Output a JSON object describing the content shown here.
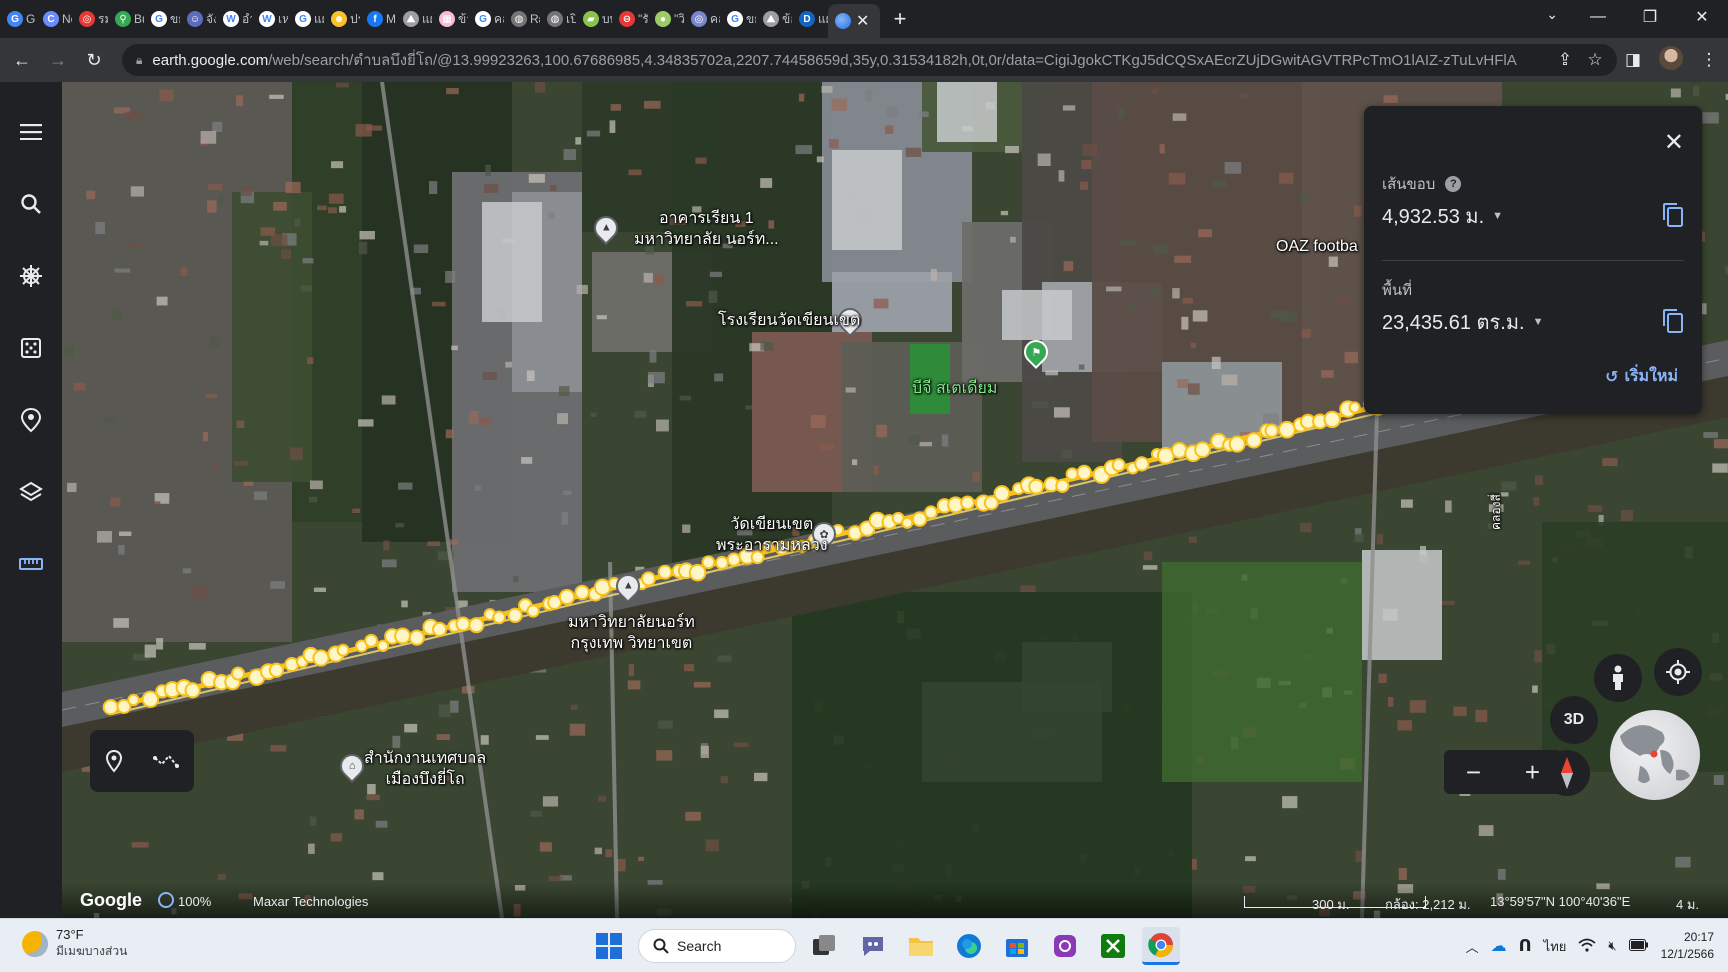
{
  "browser": {
    "tabs": [
      {
        "label": "Gc",
        "color": "#4285f4",
        "glyph": "G"
      },
      {
        "label": "Ne",
        "color": "#6b8cff",
        "glyph": "C"
      },
      {
        "label": "รม",
        "color": "#e53935",
        "glyph": "◎"
      },
      {
        "label": "Bu",
        "color": "#34a853",
        "glyph": "⚲"
      },
      {
        "label": "ขย",
        "color": "#ffffff",
        "glyph": "G"
      },
      {
        "label": "จัง",
        "color": "#5c6bc0",
        "glyph": "☺"
      },
      {
        "label": "อำ",
        "color": "#ffffff",
        "glyph": "W"
      },
      {
        "label": "เห",
        "color": "#ffffff",
        "glyph": "W"
      },
      {
        "label": "แผ",
        "color": "#ffffff",
        "glyph": "G"
      },
      {
        "label": "ปร",
        "color": "#fbc02d",
        "glyph": "☻"
      },
      {
        "label": "M",
        "color": "#1877f2",
        "glyph": "f"
      },
      {
        "label": "แผ",
        "color": "#9e9e9e",
        "glyph": "⛰"
      },
      {
        "label": "ข้า",
        "color": "#f8bbd0",
        "glyph": "▦"
      },
      {
        "label": "คล",
        "color": "#ffffff",
        "glyph": "G"
      },
      {
        "label": "Rε",
        "color": "#757575",
        "glyph": "◍"
      },
      {
        "label": "เปิ",
        "color": "#757575",
        "glyph": "◍"
      },
      {
        "label": "บท",
        "color": "#8bc34a",
        "glyph": "▰"
      },
      {
        "label": "\"รั",
        "color": "#e53935",
        "glyph": "⊖"
      },
      {
        "label": "\"วิ",
        "color": "#9ccc65",
        "glyph": "●"
      },
      {
        "label": "คล",
        "color": "#7986cb",
        "glyph": "◎"
      },
      {
        "label": "ขย",
        "color": "#ffffff",
        "glyph": "G"
      },
      {
        "label": "ข้อ",
        "color": "#9e9e9e",
        "glyph": "⛰"
      },
      {
        "label": "แผ",
        "color": "#1565c0",
        "glyph": "D"
      }
    ],
    "active_tab_glyph": "●",
    "url_host": "earth.google.com",
    "url_rest": "/web/search/ตำบลบึงยี่โถ/@13.99923263,100.67686985,4.34835702a,2207.74458659d,35y,0.31534182h,0t,0r/data=CigiJgokCTKgJ5dCQSxAEcrZUjDGwitAGVTRPcTmO1lAIZ-zTuLvHFlA"
  },
  "map": {
    "labels": {
      "building1": "อาคารเรียน 1",
      "building1_sub": "มหาวิทยาลัย นอร์ท...",
      "school": "โรงเรียนวัดเขียนเขต",
      "stadium": "บีจี สเตเดียม",
      "temple": "วัดเขียนเขต",
      "temple_sub": "พระอารามหลวง",
      "university": "มหาวิทยาลัยนอร์ท",
      "university_sub": "กรุงเทพ วิทยาเขต",
      "office": "สำนักงานเทศบาล",
      "office_sub": "เมืองบึงยี่โถ",
      "oaz": "OAZ footba",
      "road_side": "คลองสี่"
    },
    "path_color": "#f9c21a"
  },
  "measure": {
    "perimeter_label": "เส้นขอบ",
    "perimeter_value": "4,932.53 ม.",
    "area_label": "พื้นที่",
    "area_value": "23,435.61 ตร.ม.",
    "reset_label": "เริ่มใหม่"
  },
  "footer": {
    "logo": "Google",
    "progress": "100%",
    "imagery": "Maxar Technologies",
    "scale": "300 ม.",
    "camera": "กล้อง: 2,212 ม.",
    "coords": "13°59'57\"N 100°40'36\"E",
    "elevation": "4 ม.",
    "btn_3d": "3D"
  },
  "taskbar": {
    "temp": "73°F",
    "weather_desc": "มีเมฆบางส่วน",
    "search_label": "Search",
    "lang": "ไทย",
    "time": "20:17",
    "date": "12/1/2566"
  }
}
